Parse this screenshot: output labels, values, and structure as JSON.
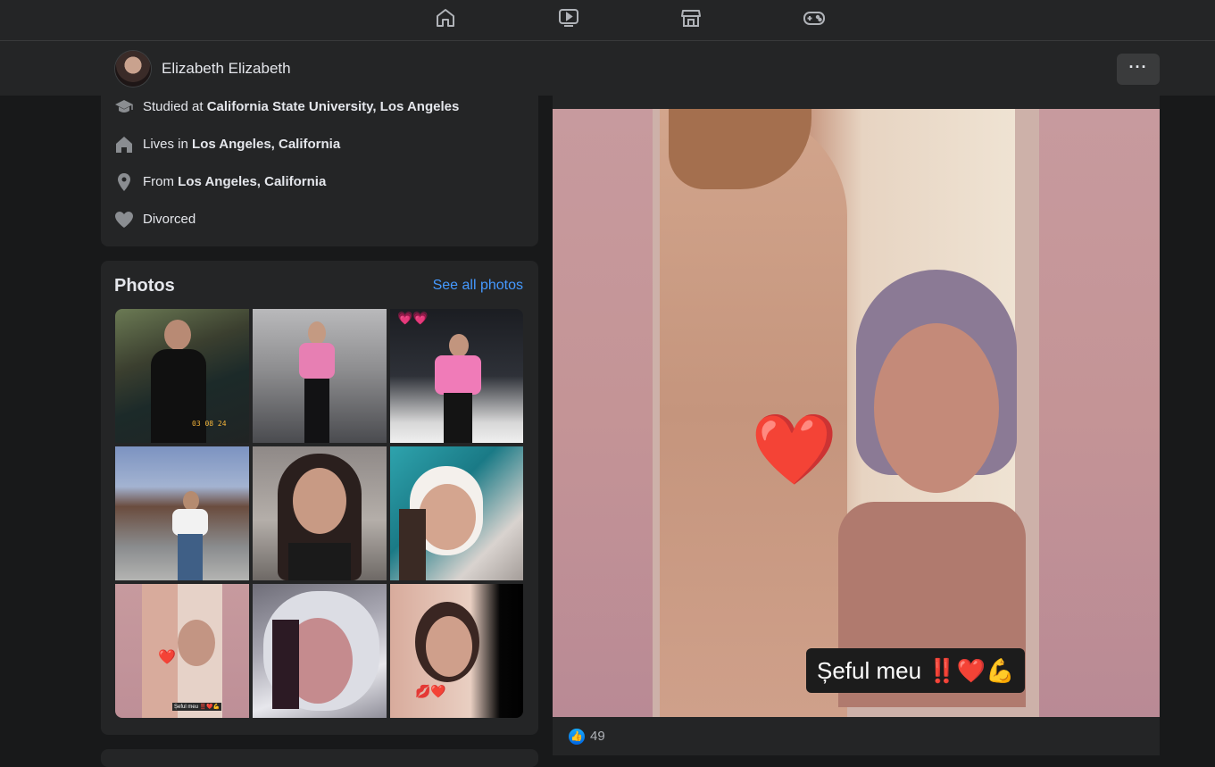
{
  "topnav": {
    "icons": [
      "home-icon",
      "watch-icon",
      "marketplace-icon",
      "gaming-icon"
    ]
  },
  "profile": {
    "name": "Elizabeth Elizabeth",
    "more_label": "···"
  },
  "intro": {
    "items": [
      {
        "icon": "graduation-cap-icon",
        "prefix": "Studied at ",
        "value": "California State University, Los Angeles"
      },
      {
        "icon": "house-icon",
        "prefix": "Lives in ",
        "value": "Los Angeles, California"
      },
      {
        "icon": "location-pin-icon",
        "prefix": "From ",
        "value": "Los Angeles, California"
      },
      {
        "icon": "heart-icon",
        "prefix": "",
        "value": "Divorced"
      }
    ]
  },
  "photos": {
    "title": "Photos",
    "see_all": "See all photos",
    "photo1_caption": "03 08 24",
    "photo7_caption": "Șeful meu ‼️❤️💪"
  },
  "post": {
    "image_caption": "Șeful meu ‼️❤️💪",
    "like_count": "49"
  },
  "colors": {
    "background": "#18191a",
    "card": "#242526",
    "link": "#4599ff",
    "like_blue": "#0866ff"
  }
}
